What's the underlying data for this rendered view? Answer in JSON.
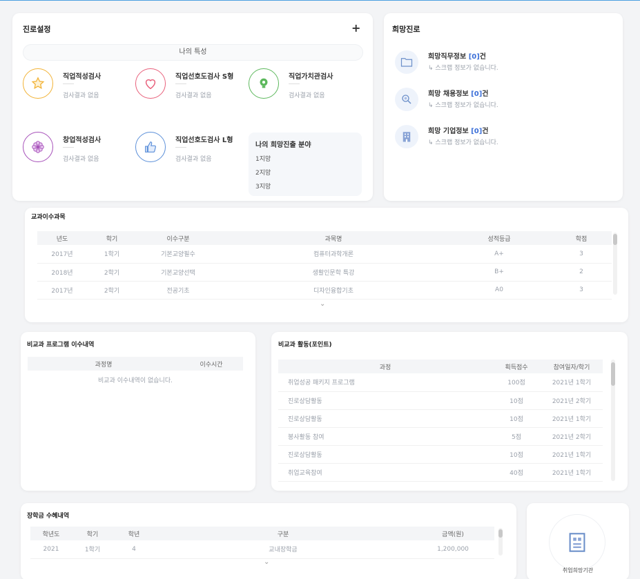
{
  "career": {
    "title": "진로설정",
    "plus": "+",
    "traits_label": "나의 특성",
    "tests": [
      {
        "name": "직업적성검사",
        "result": "검사결과 없음",
        "color": "#f2b234",
        "icon": "star-icon"
      },
      {
        "name": "직업선호도검사 S형",
        "result": "검사결과 없음",
        "color": "#e85f7a",
        "icon": "heart-icon"
      },
      {
        "name": "직업가치관검사",
        "result": "검사결과 없음",
        "color": "#5cb85c",
        "icon": "lightbulb-icon"
      },
      {
        "name": "창업적성검사",
        "result": "검사결과 없음",
        "color": "#a64fb9",
        "icon": "flower-icon"
      },
      {
        "name": "직업선호도검사 L형",
        "result": "검사결과 없음",
        "color": "#5b8fd9",
        "icon": "thumbs-up-icon"
      }
    ],
    "field": {
      "title": "나의 희망진출 분야",
      "rows": [
        "1지망",
        "2지망",
        "3지망"
      ]
    }
  },
  "hope": {
    "title": "희망진로",
    "items": [
      {
        "title_prefix": "희망직무정보 ",
        "count": "[0]",
        "title_suffix": "건",
        "sub": "↳ 스크랩 정보가 없습니다.",
        "icon": "folder-icon"
      },
      {
        "title_prefix": "희망 채용정보 ",
        "count": "[0]",
        "title_suffix": "건",
        "sub": "↳ 스크랩 정보가 없습니다.",
        "icon": "search-icon"
      },
      {
        "title_prefix": "희망 기업정보 ",
        "count": "[0]",
        "title_suffix": "건",
        "sub": "↳ 스크랩 정보가 없습니다.",
        "icon": "building-icon"
      }
    ]
  },
  "credit": {
    "title": "교과이수과목",
    "headers": [
      "년도",
      "학기",
      "이수구분",
      "과목명",
      "성적등급",
      "학점"
    ],
    "rows": [
      [
        "2017년",
        "1학기",
        "기본교양필수",
        "컴퓨터과학개론",
        "A+",
        "3"
      ],
      [
        "2018년",
        "2학기",
        "기본교양선택",
        "생활인문학 특강",
        "B+",
        "2"
      ],
      [
        "2017년",
        "2학기",
        "전공기초",
        "디자인융합기초",
        "A0",
        "3"
      ]
    ]
  },
  "program": {
    "title": "비교과 프로그램 이수내역",
    "headers": [
      "과정명",
      "이수시간"
    ],
    "empty": "비교과 이수내역이 없습니다."
  },
  "activity": {
    "title": "비교과 활동(포인트)",
    "headers": [
      "과정",
      "획득점수",
      "참여일자/학기"
    ],
    "rows": [
      [
        "취업성공 패키지 프로그램",
        "100점",
        "2021년 1학기"
      ],
      [
        "진로상담활동",
        "10점",
        "2021년 2학기"
      ],
      [
        "진로상담활동",
        "10점",
        "2021년 1학기"
      ],
      [
        "봉사활동 참여",
        "5점",
        "2021년 2학기"
      ],
      [
        "진로상담활동",
        "10점",
        "2021년 1학기"
      ],
      [
        "취업교육참여",
        "40점",
        "2021년 1학기"
      ]
    ]
  },
  "subject": {
    "title": "장학금 수혜내역",
    "headers": [
      "학년도",
      "학기",
      "학년",
      "구분",
      "금액(원)"
    ],
    "rows": [
      [
        "2021",
        "1학기",
        "4",
        "교내장학금",
        "1,200,000"
      ]
    ]
  },
  "extra": {
    "label": "취업희망기관"
  }
}
